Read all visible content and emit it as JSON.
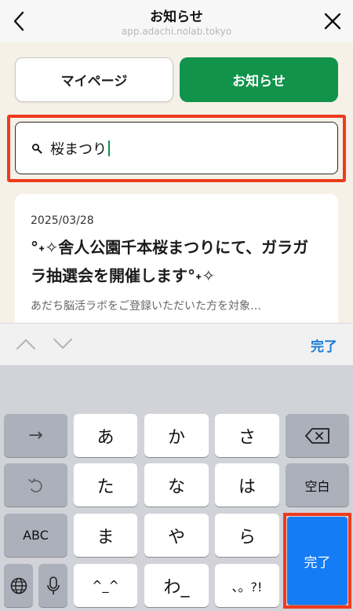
{
  "header": {
    "title": "お知らせ",
    "url": "app.adachi.nolab.tokyo",
    "back_icon": "chevron-left-icon",
    "close_icon": "close-icon"
  },
  "tabs": {
    "mypage_label": "マイページ",
    "notice_label": "お知らせ"
  },
  "search": {
    "value": "桜まつり",
    "icon": "search-icon"
  },
  "article": {
    "date": "2025/03/28",
    "title": "°˖✧舎人公園千本桜まつりにて、ガラガラ抽選会を開催します°˖✧",
    "excerpt": "あだち脳活ラボをご登録いただいた方を対象…"
  },
  "accessory": {
    "done_label": "完了"
  },
  "keyboard": {
    "arrow": "→",
    "a": "あ",
    "ka": "か",
    "sa": "さ",
    "ta": "た",
    "na": "な",
    "ha": "は",
    "space": "空白",
    "abc": "ABC",
    "ma": "ま",
    "ya": "や",
    "ra": "ら",
    "emoticon": "^_^",
    "wa": "わ_",
    "punct": "、。?!",
    "done": "完了"
  },
  "colors": {
    "accent_green": "#12934b",
    "highlight_red": "#ef3b1e",
    "key_blue": "#147cf5",
    "link_blue": "#1a7bd8"
  }
}
